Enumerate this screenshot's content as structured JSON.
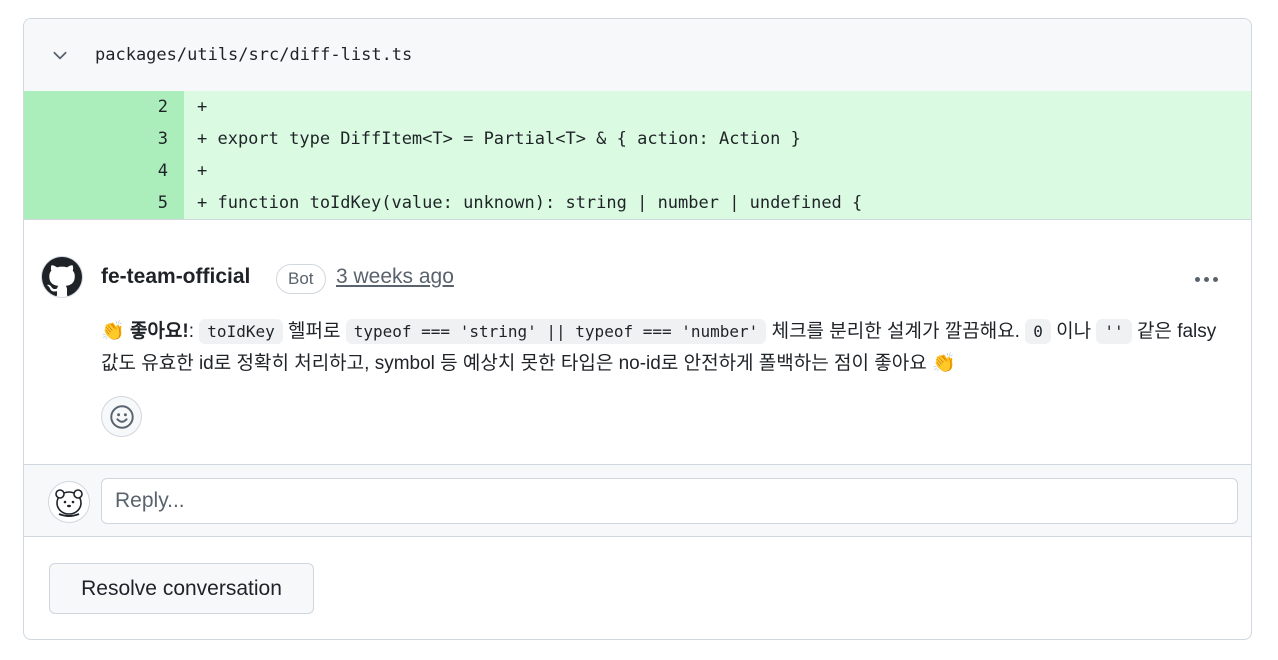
{
  "file": {
    "path": "packages/utils/src/diff-list.ts",
    "chevron_icon": "chevron-down-icon"
  },
  "diff_lines": [
    {
      "num": "2",
      "code": "+"
    },
    {
      "num": "3",
      "code": "+ export type DiffItem<T> = Partial<T> & { action: Action }"
    },
    {
      "num": "4",
      "code": "+"
    },
    {
      "num": "5",
      "code": "+ function toIdKey(value: unknown): string | number | undefined {"
    }
  ],
  "comment": {
    "author": "fe-team-official",
    "badge": "Bot",
    "time": "3 weeks ago",
    "avatar_icon": "github-mark-icon",
    "menu_icon": "kebab-horizontal-icon",
    "body": {
      "emoji_start": "👏",
      "lead": "좋아요!",
      "colon": ":",
      "code1": "toIdKey",
      "t1": " 헬퍼로 ",
      "code2": "typeof === 'string' || typeof === 'number'",
      "t2": " 체크를 분리한 설계가 깔끔해요. ",
      "code3": "0",
      "t3": " 이나",
      "code4": "''",
      "t4": " 같은 falsy 값도 유효한 id로 정확히 처리하고, symbol 등 예상치 못한 타입은 no-id로 안전하게 폴백하는 점이 좋아요 ",
      "emoji_end": "👏"
    },
    "reaction_icon": "smiley-icon"
  },
  "reply": {
    "placeholder": "Reply...",
    "avatar_icon": "user-avatar-icon"
  },
  "actions": {
    "resolve_label": "Resolve conversation"
  }
}
